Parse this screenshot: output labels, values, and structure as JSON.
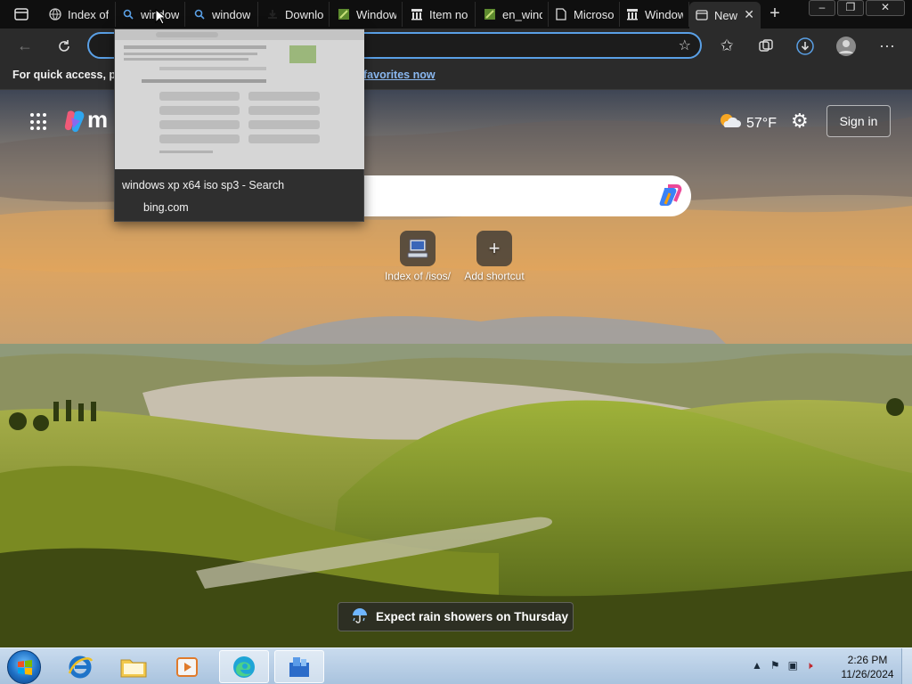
{
  "browser": {
    "tabs": [
      {
        "title": "Index of",
        "icon": "globe-icon"
      },
      {
        "title": "window",
        "icon": "search-icon"
      },
      {
        "title": "window",
        "icon": "search-icon"
      },
      {
        "title": "Downlo",
        "icon": "download-icon"
      },
      {
        "title": "Window",
        "icon": "app-icon"
      },
      {
        "title": "Item no",
        "icon": "archive-icon"
      },
      {
        "title": "en_wind",
        "icon": "app-icon"
      },
      {
        "title": "Microso",
        "icon": "page-icon"
      },
      {
        "title": "Window",
        "icon": "archive-icon"
      },
      {
        "title": "New",
        "icon": "newtab-icon"
      }
    ],
    "favorites_bar": {
      "text": "For quick access, plac",
      "link": "favorites now"
    },
    "tab_preview": {
      "title": "windows xp x64 iso sp3 - Search",
      "host": "bing.com"
    }
  },
  "new_tab_page": {
    "logo_text": "m",
    "weather": {
      "temp": "57°F"
    },
    "sign_in_label": "Sign in",
    "shortcuts": [
      {
        "label": "Index of /isos/"
      },
      {
        "label": "Add shortcut"
      }
    ],
    "news_pill": "Expect rain showers on Thursday"
  },
  "taskbar": {
    "time": "2:26 PM",
    "date": "11/26/2024"
  }
}
